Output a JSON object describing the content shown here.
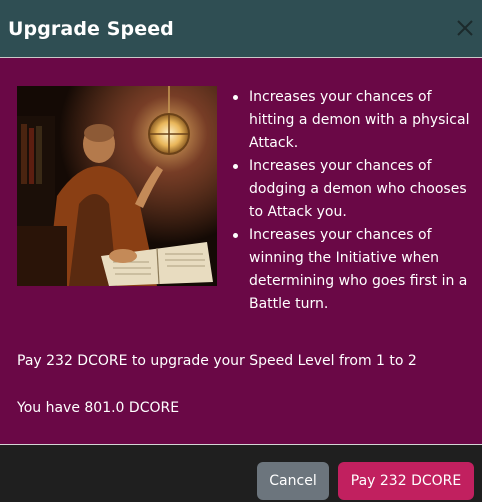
{
  "modal": {
    "title": "Upgrade Speed",
    "close_icon": "close-icon"
  },
  "body": {
    "image": "monk-reading-book-with-lantern",
    "bullets": [
      "Increases your chances of hitting a demon with a physical Attack.",
      "Increases your chances of dodging a demon who chooses to Attack you.",
      "Increases your chances of winning the Initiative when determining who goes first in a Battle turn."
    ],
    "upgrade_text": "Pay 232 DCORE to upgrade your Speed Level from 1 to 2",
    "balance_text": "You have 801.0 DCORE"
  },
  "footer": {
    "cancel_label": "Cancel",
    "pay_label": "Pay 232 DCORE"
  },
  "colors": {
    "header_bg": "#2f4e53",
    "body_bg": "#6a0846",
    "footer_bg": "#1f1f1f",
    "cancel_bg": "#6c757d",
    "pay_bg": "#c1205f"
  }
}
